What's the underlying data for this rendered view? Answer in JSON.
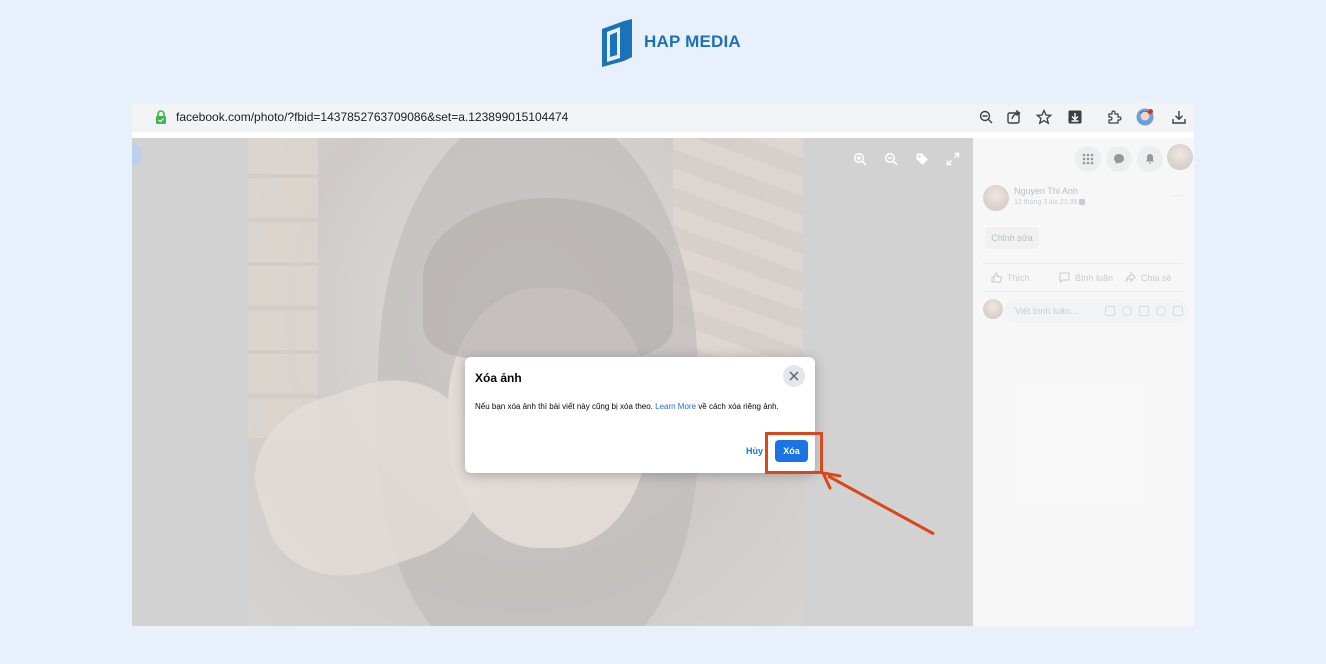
{
  "brand": {
    "name": "HAP MEDIA",
    "color": "#1c72b8"
  },
  "browser": {
    "url": "facebook.com/photo/?fbid=1437852763709086&set=a.123899015104474",
    "toolbar_icons": [
      "zoom-out-icon",
      "share-icon",
      "star-icon",
      "download-box-icon",
      "extensions-icon",
      "profile-avatar",
      "download-icon"
    ]
  },
  "viewer": {
    "tools": [
      "zoom-in-icon",
      "zoom-out-icon",
      "tag-icon",
      "fullscreen-icon"
    ]
  },
  "panel": {
    "top_icons": [
      "menu-grid-icon",
      "messenger-icon",
      "bell-icon",
      "account-avatar"
    ],
    "post": {
      "author": "Nguyen Thi Anh",
      "date": "12 tháng 3 lúc 21:38",
      "more": "···",
      "edit_label": "Chỉnh sửa"
    },
    "actions": {
      "like": "Thích",
      "comment": "Bình luận",
      "share": "Chia sẻ"
    },
    "comment_placeholder": "Viết bình luận..."
  },
  "dialog": {
    "title": "Xóa ảnh",
    "body_prefix": "Nếu bạn xóa ảnh thì bài viết này cũng bị xóa theo. ",
    "body_link": "Learn More",
    "body_suffix": " về cách xóa riêng ảnh.",
    "cancel_label": "Hủy",
    "delete_label": "Xóa"
  },
  "annotation": {
    "color": "#d9471c"
  }
}
